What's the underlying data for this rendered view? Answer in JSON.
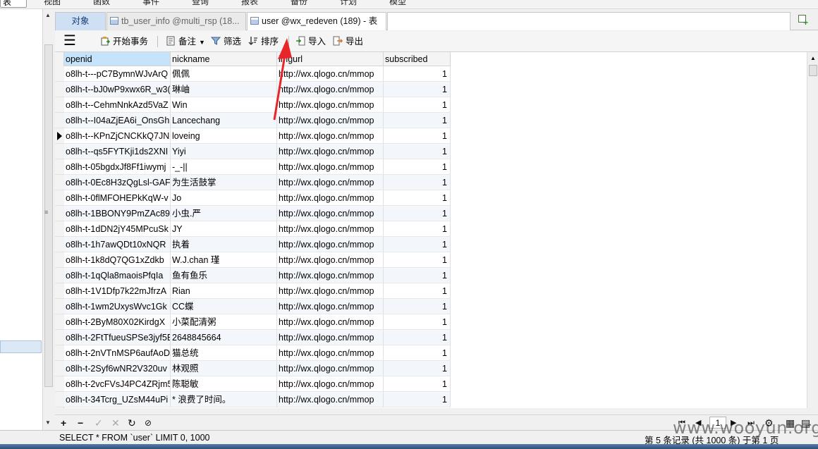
{
  "menu": {
    "items": [
      "表",
      "视图",
      "函数",
      "事件",
      "查询",
      "报表",
      "备份",
      "计划",
      "模型"
    ]
  },
  "tabs": {
    "objects": "对象",
    "tab1": "tb_user_info @multi_rsp (18...",
    "tab2": "user @wx_redeven (189) - 表"
  },
  "toolbar": {
    "begin_transaction": "开始事务",
    "note": "备注",
    "filter": "筛选",
    "sort": "排序",
    "import": "导入",
    "export": "导出"
  },
  "table": {
    "columns": [
      "openid",
      "nickname",
      "imgurl",
      "subscribed"
    ],
    "rows": [
      [
        "o8lh-t---pC7BymnWJvArQ",
        "佩佩",
        "http://wx.qlogo.cn/mmop",
        "1"
      ],
      [
        "o8lh-t--bJ0wP9xwx6R_w3(",
        "琳岫",
        "http://wx.qlogo.cn/mmop",
        "1"
      ],
      [
        "o8lh-t--CehmNnkAzd5VaZ",
        "Win",
        "http://wx.qlogo.cn/mmop",
        "1"
      ],
      [
        "o8lh-t--I04aZjEA6i_OnsGh",
        "Lancechang",
        "http://wx.qlogo.cn/mmop",
        "1"
      ],
      [
        "o8lh-t--KPnZjCNCKkQ7JN",
        "loveing",
        "http://wx.qlogo.cn/mmop",
        "1"
      ],
      [
        "o8lh-t--qs5FYTKji1ds2XNI",
        "Yiyi",
        "http://wx.qlogo.cn/mmop",
        "1"
      ],
      [
        "o8lh-t-05bgdxJf8Ff1iwymj",
        "-_-||",
        "http://wx.qlogo.cn/mmop",
        "1"
      ],
      [
        "o8lh-t-0Ec8H3zQgLsl-GAF",
        "为生活鼓掌",
        "http://wx.qlogo.cn/mmop",
        "1"
      ],
      [
        "o8lh-t-0flMFOHEPkKqW-v",
        "Jo",
        "http://wx.qlogo.cn/mmop",
        "1"
      ],
      [
        "o8lh-t-1BBONY9PmZAc89",
        "小虫.严",
        "http://wx.qlogo.cn/mmop",
        "1"
      ],
      [
        "o8lh-t-1dDN2jY45MPcuSk",
        "JY",
        "http://wx.qlogo.cn/mmop",
        "1"
      ],
      [
        "o8lh-t-1h7awQDt10xNQR",
        "执着",
        "http://wx.qlogo.cn/mmop",
        "1"
      ],
      [
        "o8lh-t-1k8dQ7QG1xZdkb",
        "W.J.chan 瑾",
        "http://wx.qlogo.cn/mmop",
        "1"
      ],
      [
        "o8lh-t-1qQla8maoisPfqIa",
        "鱼有鱼乐",
        "http://wx.qlogo.cn/mmop",
        "1"
      ],
      [
        "o8lh-t-1V1Dfp7k22mJfrzA",
        "Rian",
        "http://wx.qlogo.cn/mmop",
        "1"
      ],
      [
        "o8lh-t-1wm2UxysWvc1Gk",
        "CC蝶",
        "http://wx.qlogo.cn/mmop",
        "1"
      ],
      [
        "o8lh-t-2ByM80X02KirdgX",
        "小菜配清粥",
        "http://wx.qlogo.cn/mmop",
        "1"
      ],
      [
        "o8lh-t-2FtTfueuSPSe3jyf5E",
        "2648845664",
        "http://wx.qlogo.cn/mmop",
        "1"
      ],
      [
        "o8lh-t-2nVTnMSP6aufAoD",
        "  猫总统",
        "http://wx.qlogo.cn/mmop",
        "1"
      ],
      [
        "o8lh-t-2Syf6wNR2V320uv",
        "林观照",
        "http://wx.qlogo.cn/mmop",
        "1"
      ],
      [
        "o8lh-t-2vcFVsJ4PC4ZRjm5",
        "陈聪敏",
        "http://wx.qlogo.cn/mmop",
        "1"
      ],
      [
        "o8lh-t-34Tcrg_UZsM44uPi",
        " * 浪费了时间。",
        "http://wx.qlogo.cn/mmop",
        "1"
      ]
    ]
  },
  "navigation": {
    "page": "1"
  },
  "status": {
    "sql": "SELECT * FROM `user` LIMIT 0, 1000",
    "records": "第 5 条记录 (共 1000 条) 于第 1 页"
  },
  "watermark": "www.wooyun.org",
  "colors": {
    "active_header": "#c5e3fa",
    "annotation_arrow": "#e8262a",
    "selected_tab": "#cfe0f5"
  }
}
